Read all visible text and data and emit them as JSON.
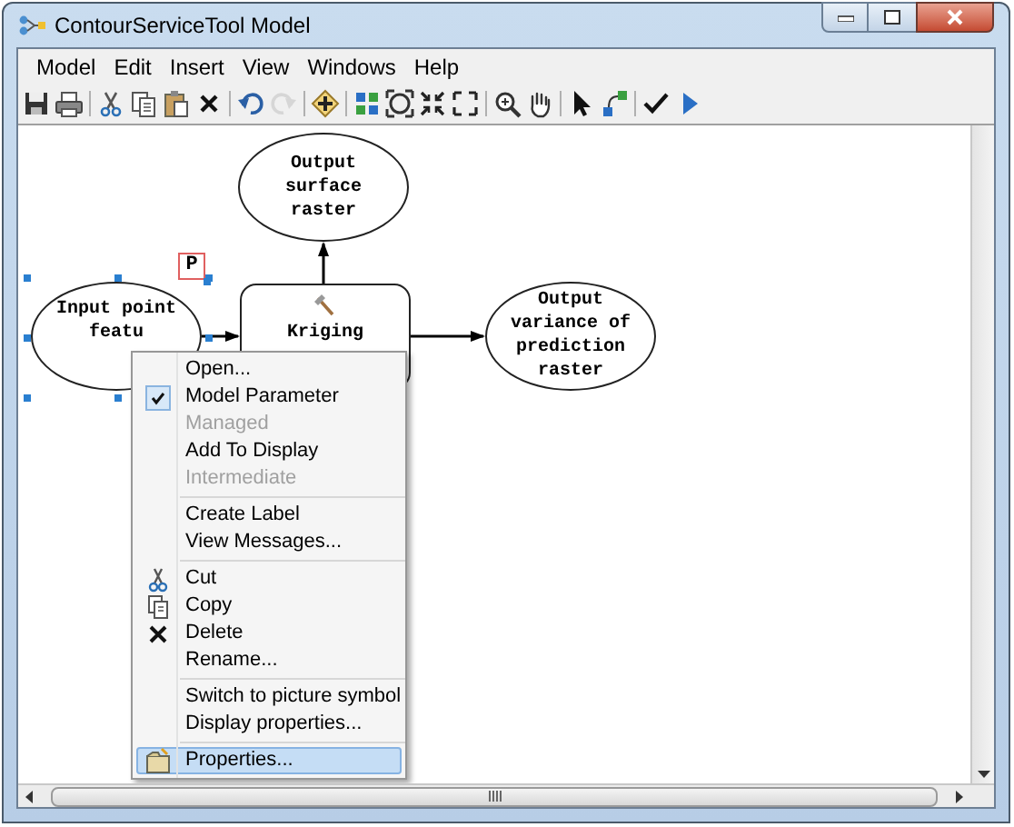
{
  "window": {
    "title": "ContourServiceTool Model"
  },
  "menu_bar": [
    "Model",
    "Edit",
    "Insert",
    "View",
    "Windows",
    "Help"
  ],
  "toolbar": [
    {
      "kind": "save",
      "disabled": false
    },
    {
      "kind": "print",
      "disabled": false
    },
    {
      "kind": "separator"
    },
    {
      "kind": "cut",
      "disabled": false
    },
    {
      "kind": "copy",
      "disabled": false
    },
    {
      "kind": "paste",
      "disabled": false
    },
    {
      "kind": "delete",
      "disabled": false
    },
    {
      "kind": "separator"
    },
    {
      "kind": "undo",
      "disabled": false
    },
    {
      "kind": "redo",
      "disabled": true
    },
    {
      "kind": "separator"
    },
    {
      "kind": "add",
      "disabled": false
    },
    {
      "kind": "separator"
    },
    {
      "kind": "layout",
      "disabled": false
    },
    {
      "kind": "extent",
      "disabled": false
    },
    {
      "kind": "shrink",
      "disabled": false
    },
    {
      "kind": "expand",
      "disabled": false
    },
    {
      "kind": "separator"
    },
    {
      "kind": "zoom",
      "disabled": false
    },
    {
      "kind": "pan",
      "disabled": false
    },
    {
      "kind": "separator"
    },
    {
      "kind": "pointer",
      "disabled": false
    },
    {
      "kind": "connect",
      "disabled": false
    },
    {
      "kind": "separator"
    },
    {
      "kind": "validate",
      "disabled": false
    },
    {
      "kind": "run",
      "disabled": false
    }
  ],
  "diagram": {
    "nodes": [
      {
        "kind": "data",
        "lines": [
          "Output",
          "surface",
          "raster"
        ],
        "selected": false
      },
      {
        "kind": "data",
        "lines": [
          "Input point",
          "featu"
        ],
        "selected": true,
        "parameter": "P"
      },
      {
        "kind": "tool",
        "lines": [
          "Kriging"
        ],
        "selected": false
      },
      {
        "kind": "data",
        "lines": [
          "Output",
          "variance of",
          "prediction",
          "raster"
        ],
        "selected": false
      }
    ]
  },
  "context_menu": [
    {
      "kind": "plain",
      "label": "Open...",
      "checked": false,
      "disabled": false,
      "selected": false
    },
    {
      "kind": "plain",
      "label": "Model Parameter",
      "checked": true,
      "disabled": false,
      "selected": false
    },
    {
      "kind": "plain",
      "label": "Managed",
      "checked": false,
      "disabled": true,
      "selected": false
    },
    {
      "kind": "plain",
      "label": "Add To Display",
      "checked": false,
      "disabled": false,
      "selected": false
    },
    {
      "kind": "plain",
      "label": "Intermediate",
      "checked": false,
      "disabled": true,
      "selected": false
    },
    {
      "kind": "separator"
    },
    {
      "kind": "plain",
      "label": "Create Label",
      "checked": false,
      "disabled": false,
      "selected": false
    },
    {
      "kind": "plain",
      "label": "View Messages...",
      "checked": false,
      "disabled": false,
      "selected": false
    },
    {
      "kind": "separator"
    },
    {
      "kind": "cut",
      "label": "Cut",
      "checked": false,
      "disabled": false,
      "selected": false
    },
    {
      "kind": "copy",
      "label": "Copy",
      "checked": false,
      "disabled": false,
      "selected": false
    },
    {
      "kind": "delete",
      "label": "Delete",
      "checked": false,
      "disabled": false,
      "selected": false
    },
    {
      "kind": "plain",
      "label": "Rename...",
      "checked": false,
      "disabled": false,
      "selected": false
    },
    {
      "kind": "separator"
    },
    {
      "kind": "plain",
      "label": "Switch to picture symbol",
      "checked": false,
      "disabled": false,
      "selected": false
    },
    {
      "kind": "plain",
      "label": "Display properties...",
      "checked": false,
      "disabled": false,
      "selected": false
    },
    {
      "kind": "separator"
    },
    {
      "kind": "properties",
      "label": "Properties...",
      "checked": false,
      "disabled": false,
      "selected": true
    }
  ]
}
